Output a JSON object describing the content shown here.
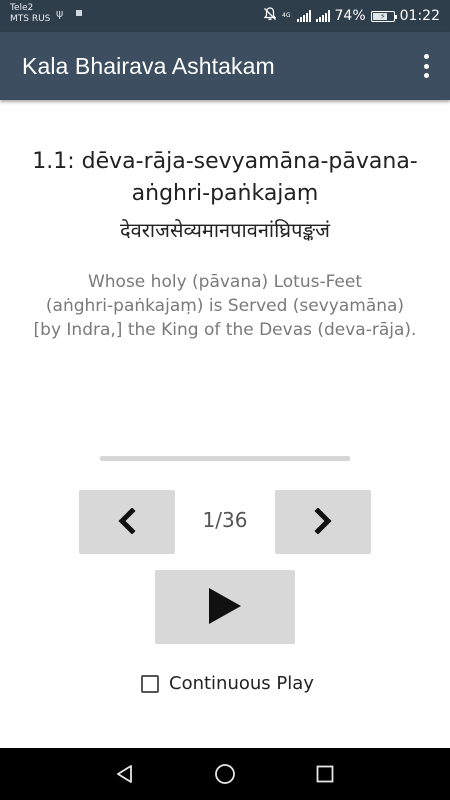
{
  "status_bar": {
    "carrier_1": "Tele2",
    "carrier_2": "MTS RUS",
    "network_label": "4G",
    "battery_percent": "74%",
    "battery_level": 0.74,
    "time": "01:22",
    "icons": [
      "usb-icon",
      "notification-square-icon",
      "mute-icon",
      "signal-icon",
      "battery-icon"
    ]
  },
  "app_bar": {
    "title": "Kala Bhairava Ashtakam",
    "overflow_icon": "more-vert-icon"
  },
  "verse": {
    "title_line_1": "1.1: dēva-rāja-sevyamāna-pāvana-",
    "title_line_2": "aṅghri-paṅkajaṃ",
    "devanagari": "देवराजसेव्यमानपावनांघ्रिपङ्कजं",
    "translation_line_1": "Whose holy (pāvana) Lotus-Feet",
    "translation_line_2": "(aṅghri-paṅkajaṃ) is Served (sevyamāna)",
    "translation_line_3": "[by Indra,] the King of the Devas (deva-rāja)."
  },
  "player": {
    "progress": 0.0,
    "counter": "1/36",
    "prev_icon": "chevron-left-icon",
    "next_icon": "chevron-right-icon",
    "play_icon": "play-icon",
    "continuous_play_label": "Continuous Play",
    "continuous_play_checked": false
  },
  "nav_bar": {
    "icons": [
      "back-icon",
      "home-icon",
      "recents-icon"
    ]
  },
  "colors": {
    "status_bar": "#2f3e4b",
    "app_bar": "#3c4e5f",
    "button": "#d8d8d8"
  }
}
